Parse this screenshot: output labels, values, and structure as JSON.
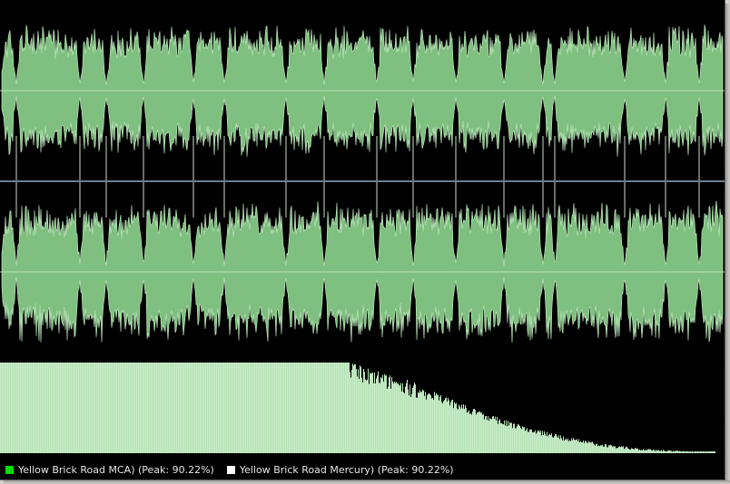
{
  "colors": {
    "background": "#000000",
    "waveform_fill": "#7fbf7f",
    "waveform_stroke": "#c8f0c8",
    "spectrum_fill": "#c8ecc8",
    "divider": "#6e7c8c",
    "legend_swatch_a": "#00dd00",
    "legend_swatch_b": "#ffffff"
  },
  "legend": {
    "items": [
      {
        "label": "Yellow Brick Road MCA) (Peak: 90.22%)",
        "color": "#00dd00"
      },
      {
        "label": "Yellow Brick Road Mercury) (Peak: 90.22%)",
        "color": "#ffffff"
      }
    ]
  },
  "waveform": {
    "channels": [
      "left",
      "right"
    ],
    "peak_percent": 90.22
  }
}
